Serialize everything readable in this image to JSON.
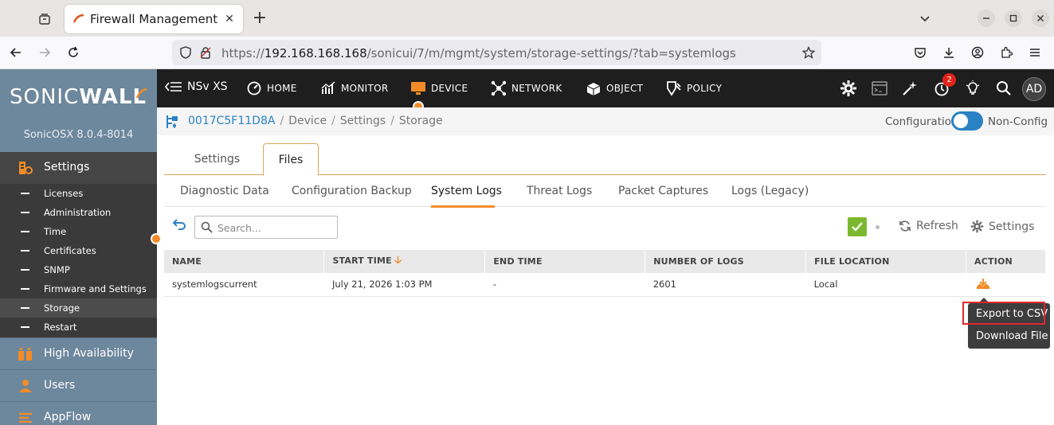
{
  "browser": {
    "tab_title": "Firewall Management",
    "url_prefix": "https://",
    "url_host": "192.168.168.168",
    "url_path": "/sonicui/7/m/mgmt/system/storage-settings/?tab=systemlogs"
  },
  "sidebar": {
    "logo_light": "SONIC",
    "logo_bold": "WALL",
    "version": "SonicOSX 8.0.4-8014",
    "settings_label": "Settings",
    "items": [
      {
        "label": "Licenses"
      },
      {
        "label": "Administration"
      },
      {
        "label": "Time"
      },
      {
        "label": "Certificates"
      },
      {
        "label": "SNMP"
      },
      {
        "label": "Firmware and Settings"
      },
      {
        "label": "Storage"
      },
      {
        "label": "Restart"
      }
    ],
    "sections": [
      {
        "label": "High Availability",
        "icon": "high-availability-icon"
      },
      {
        "label": "Users",
        "icon": "user-icon"
      },
      {
        "label": "AppFlow",
        "icon": "appflow-icon"
      }
    ]
  },
  "topnav": {
    "product": "NSv XS",
    "items": [
      {
        "label": "HOME",
        "icon": "dashboard-icon"
      },
      {
        "label": "MONITOR",
        "icon": "chart-icon"
      },
      {
        "label": "DEVICE",
        "icon": "monitor-icon"
      },
      {
        "label": "NETWORK",
        "icon": "network-icon"
      },
      {
        "label": "OBJECT",
        "icon": "object-icon"
      },
      {
        "label": "POLICY",
        "icon": "policy-icon"
      }
    ],
    "notification_count": "2",
    "avatar": "AD",
    "accent": "#f28c28"
  },
  "breadcrumb": {
    "device": "0017C5F11D8A",
    "path": [
      "Device",
      "Settings",
      "Storage"
    ],
    "config_label": "Configuration",
    "nonconfig_label": "Non-Config"
  },
  "main_tabs": [
    {
      "label": "Settings"
    },
    {
      "label": "Files"
    }
  ],
  "sub_tabs": [
    {
      "label": "Diagnostic Data"
    },
    {
      "label": "Configuration Backup"
    },
    {
      "label": "System Logs"
    },
    {
      "label": "Threat Logs"
    },
    {
      "label": "Packet Captures"
    },
    {
      "label": "Logs (Legacy)"
    }
  ],
  "toolbar": {
    "search_placeholder": "Search...",
    "refresh_label": "Refresh",
    "settings_label": "Settings"
  },
  "table": {
    "columns": [
      "NAME",
      "START TIME",
      "END TIME",
      "NUMBER OF LOGS",
      "FILE LOCATION",
      "ACTION"
    ],
    "rows": [
      {
        "name": "systemlogscurrent",
        "start": "July 21, 2026 1:03 PM",
        "end": "-",
        "count": "2601",
        "location": "Local"
      }
    ]
  },
  "action_menu": {
    "items": [
      "Export to CSV",
      "Download File"
    ]
  }
}
